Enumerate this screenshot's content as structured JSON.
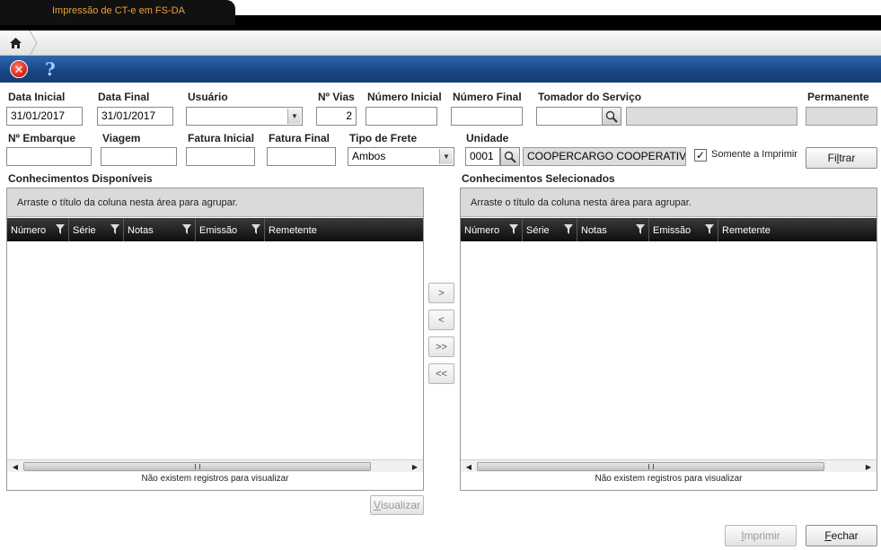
{
  "window": {
    "title": "Impressão de CT-e em FS-DA"
  },
  "icons": {
    "home": "home-icon",
    "close": "close-icon",
    "help": "help-icon",
    "lookup": "magnifier-icon",
    "filter": "filter-icon"
  },
  "colors": {
    "toolbar": "#1a4685",
    "title_text": "#e8a13a",
    "grid_header": "#1a1a1a"
  },
  "toolbar": {
    "close_glyph": "✕",
    "help_glyph": "?"
  },
  "form": {
    "data_inicial": {
      "label": "Data Inicial",
      "value": "31/01/2017"
    },
    "data_final": {
      "label": "Data Final",
      "value": "31/01/2017"
    },
    "usuario": {
      "label": "Usuário",
      "value": ""
    },
    "n_vias": {
      "label": "Nº Vias",
      "value": "2"
    },
    "numero_inicial": {
      "label": "Número Inicial",
      "value": ""
    },
    "numero_final": {
      "label": "Número Final",
      "value": ""
    },
    "tomador": {
      "label": "Tomador do Serviço",
      "code": "",
      "name": ""
    },
    "permanente": {
      "label": "Permanente",
      "value": ""
    },
    "n_embarque": {
      "label": "Nº Embarque",
      "value": ""
    },
    "viagem": {
      "label": "Viagem",
      "value": ""
    },
    "fatura_inicial": {
      "label": "Fatura Inicial",
      "value": ""
    },
    "fatura_final": {
      "label": "Fatura Final",
      "value": ""
    },
    "tipo_frete": {
      "label": "Tipo de Frete",
      "value": "Ambos"
    },
    "unidade": {
      "label": "Unidade",
      "code": "0001",
      "name": "COOPERCARGO COOPERATIVA"
    },
    "somente_imprimir": {
      "label": "Somente a Imprimir",
      "checked": true,
      "mark": "✓"
    },
    "filtrar": {
      "label_pre": "Fi",
      "label_u": "l",
      "label_post": "trar"
    }
  },
  "disponiveis": {
    "title": "Conhecimentos Disponíveis",
    "group_hint": "Arraste o título da coluna nesta área para agrupar.",
    "columns": [
      "Número",
      "Série",
      "Notas",
      "Emissão",
      "Remetente"
    ],
    "empty": "Não existem registros para visualizar"
  },
  "selecionados": {
    "title": "Conhecimentos Selecionados",
    "group_hint": "Arraste o título da coluna nesta área para agrupar.",
    "columns": [
      "Número",
      "Série",
      "Notas",
      "Emissão",
      "Remetente"
    ],
    "empty": "Não existem registros para visualizar"
  },
  "move": {
    "add_one": ">",
    "remove_one": "<",
    "add_all": ">>",
    "remove_all": "<<"
  },
  "scroll": {
    "left": "◀",
    "right": "▶"
  },
  "buttons": {
    "visualizar": {
      "u": "V",
      "rest": "isualizar"
    },
    "imprimir": {
      "u": "I",
      "rest": "mprimir"
    },
    "fechar": {
      "u": "F",
      "rest": "echar"
    }
  }
}
